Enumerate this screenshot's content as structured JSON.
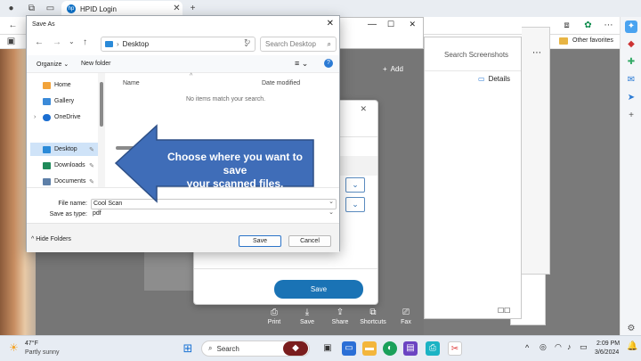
{
  "browser": {
    "tab_title": "HPID Login",
    "other_favorites": "Other favorites"
  },
  "screenshots_app": {
    "search": "Search Screenshots",
    "details": "Details"
  },
  "scanner": {
    "add_label": "Add",
    "save_button": "Save",
    "tools": [
      "Print",
      "Save",
      "Share",
      "Shortcuts",
      "Fax"
    ]
  },
  "dialog": {
    "title": "Save As",
    "path": "Desktop",
    "search_placeholder": "Search Desktop",
    "organize": "Organize",
    "new_folder": "New folder",
    "nav_items": [
      "Home",
      "Gallery",
      "OneDrive",
      "Desktop",
      "Downloads",
      "Documents"
    ],
    "col_name": "Name",
    "col_date": "Date modified",
    "empty_msg": "No items match your search.",
    "file_name_label": "File name:",
    "file_name_value": "Cool Scan",
    "save_type_label": "Save as type:",
    "save_type_value": "pdf",
    "hide_folders": "Hide Folders",
    "save_button": "Save",
    "cancel_button": "Cancel"
  },
  "callout": {
    "line1": "Choose where you want to save",
    "line2": "your scanned files."
  },
  "taskbar": {
    "weather_temp": "47°F",
    "weather_desc": "Partly sunny",
    "search_label": "Search",
    "time": "2:09 PM",
    "date": "3/6/2024"
  },
  "colors": {
    "accent": "#1a73b5",
    "callout_fill": "#3f6db8",
    "callout_border": "#2d4f86"
  }
}
